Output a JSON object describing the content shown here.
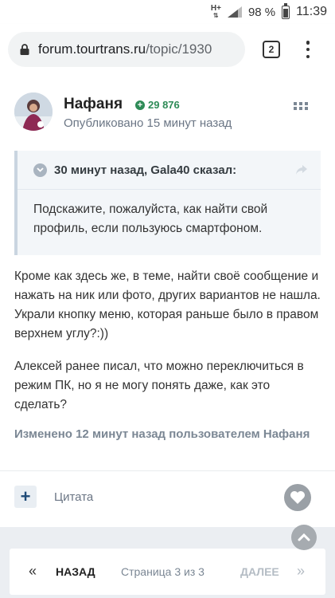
{
  "status_bar": {
    "network": "H+",
    "battery": "98 %",
    "time": "11:39"
  },
  "browser": {
    "url_host": "forum.tourtrans.ru",
    "url_path": "/topic/1930",
    "tab_count": "2"
  },
  "post": {
    "author": "Нафаня",
    "reputation": "29 876",
    "published": "Опубликовано 15 минут назад",
    "quote": {
      "header": "30 минут назад, Gala40 сказал:",
      "text": "Подскажите, пожалуйста, как найти свой профиль, если пользуюсь смартфоном."
    },
    "paragraphs": [
      "Кроме как здесь же, в теме, найти своё сообщение и нажать на ник или фото, других вариантов не нашла. Украли кнопку меню, которая раньше было в правом верхнем углу?:))",
      "Алексей ранее писал, что можно переключиться в режим ПК, но я не могу понять даже, как это сделать?"
    ],
    "edited": "Изменено 12 минут назад пользователем Нафаня",
    "actions": {
      "quote_label": "Цитата"
    }
  },
  "pagination": {
    "prev_arrow": "«",
    "prev_label": "НАЗАД",
    "info": "Страница 3 из 3",
    "next_label": "ДАЛЕЕ",
    "next_arrow": "»"
  }
}
